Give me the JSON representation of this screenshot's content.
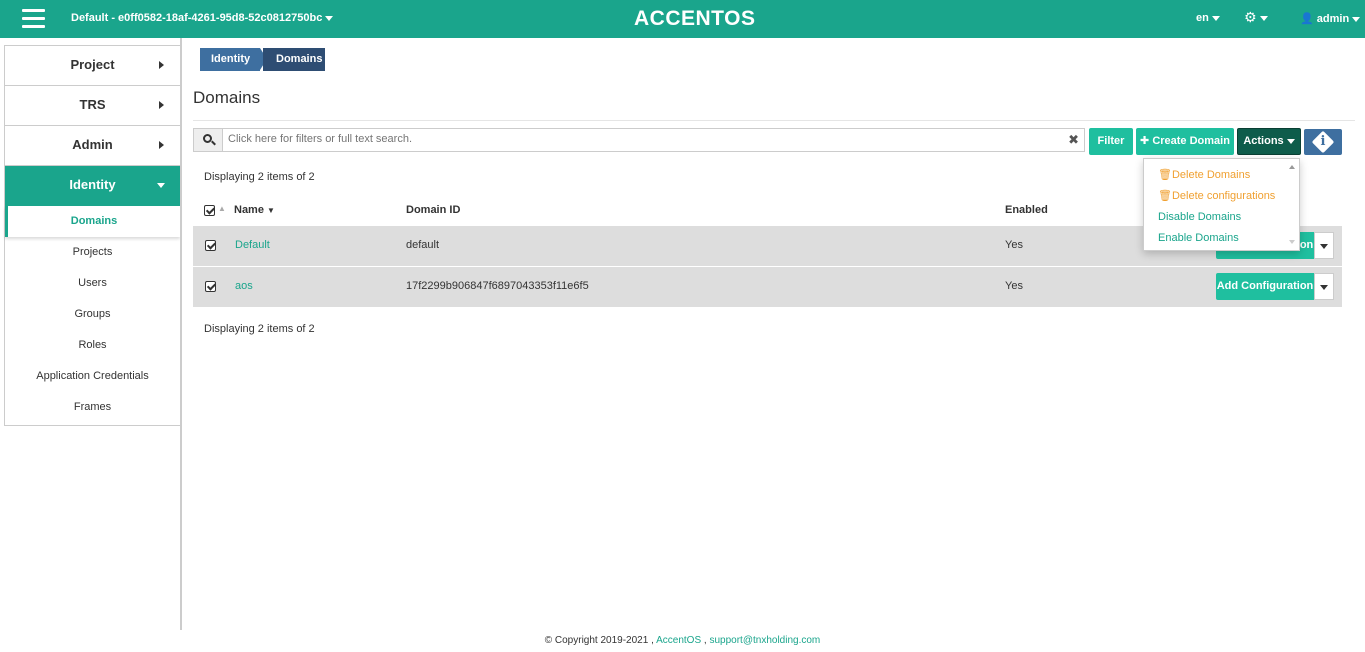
{
  "header": {
    "project": "Default - e0ff0582-18af-4261-95d8-52c0812750bc",
    "logo": "ACCENTOS",
    "lang": "en",
    "user": "admin"
  },
  "sidebar": {
    "sections": [
      {
        "label": "Project"
      },
      {
        "label": "TRS"
      },
      {
        "label": "Admin"
      },
      {
        "label": "Identity"
      }
    ],
    "items": [
      {
        "label": "Domains"
      },
      {
        "label": "Projects"
      },
      {
        "label": "Users"
      },
      {
        "label": "Groups"
      },
      {
        "label": "Roles"
      },
      {
        "label": "Application Credentials"
      },
      {
        "label": "Frames"
      }
    ]
  },
  "breadcrumb": {
    "parent": "Identity",
    "current": "Domains"
  },
  "page_title": "Domains",
  "search": {
    "placeholder": "Click here for filters or full text search."
  },
  "toolbar": {
    "filter": "Filter",
    "create": "Create Domain",
    "actions": "Actions"
  },
  "actions_menu": {
    "delete_domains": "Delete Domains",
    "delete_configurations": "Delete configurations",
    "disable_domains": "Disable Domains",
    "enable_domains": "Enable Domains"
  },
  "table": {
    "count_text": "Displaying 2 items of 2",
    "columns": {
      "name": "Name",
      "domain_id": "Domain ID",
      "enabled": "Enabled"
    },
    "rows": [
      {
        "name": "Default",
        "domain_id": "default",
        "enabled": "Yes",
        "action": "Add Configuration"
      },
      {
        "name": "aos",
        "domain_id": "17f2299b906847f6897043353f11e6f5",
        "enabled": "Yes",
        "action": "Add Configuration"
      }
    ]
  },
  "footer": {
    "copyright": "© Copyright 2019-2021 ,",
    "brand": "AccentOS",
    "sep": ",",
    "email": "support@tnxholding.com"
  },
  "colors": {
    "accent": "#1aa58c",
    "button": "#1fbf9f",
    "dark_button": "#0e5c4b",
    "breadcrumb": "#3e6fa0"
  }
}
